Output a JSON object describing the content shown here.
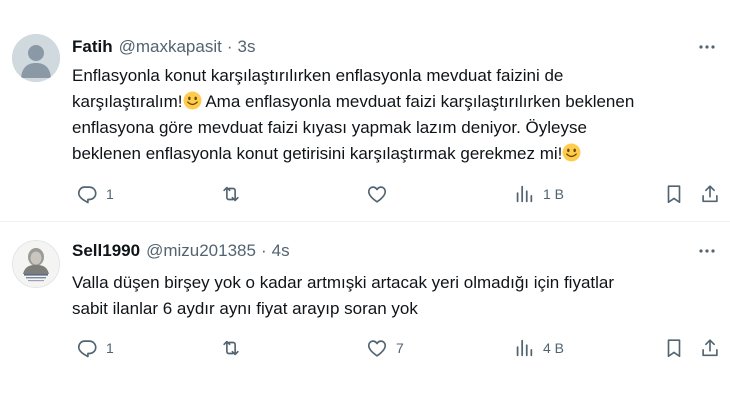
{
  "tweets": [
    {
      "name": "Fatih",
      "handle": "@maxkapasit",
      "separator": "·",
      "time": "3s",
      "lines": [
        "Enflasyonla konut karşılaştırılırken enflasyonla mevduat faizini de",
        "karşılaştıralım!",
        " Ama enflasyonla mevduat faizi karşılaştırılırken beklenen",
        "enflasyona göre mevduat faizi kıyası yapmak lazım deniyor. Öyleyse",
        "beklenen enflasyonla konut getirisini karşılaştırmak gerekmez mi!"
      ],
      "stats": {
        "replies": "1",
        "retweets": "",
        "likes": "",
        "views": "1 B"
      },
      "avatar_icon": "default-profile-icon"
    },
    {
      "name": "Sell1990",
      "handle": "@mizu201385",
      "separator": "·",
      "time": "4s",
      "lines": [
        "Valla düşen birşey yok o kadar artmışki artacak yeri olmadığı için fiyatlar",
        "sabit ilanlar 6 aydır aynı fiyat arayıp soran yok"
      ],
      "stats": {
        "replies": "1",
        "retweets": "",
        "likes": "7",
        "views": "4 B"
      },
      "avatar_icon": "portrait-photo-icon"
    }
  ],
  "colors": {
    "text": "#0f1419",
    "secondary": "#536471",
    "divider": "#eff3f4",
    "emoji": "#ffcc4d"
  }
}
